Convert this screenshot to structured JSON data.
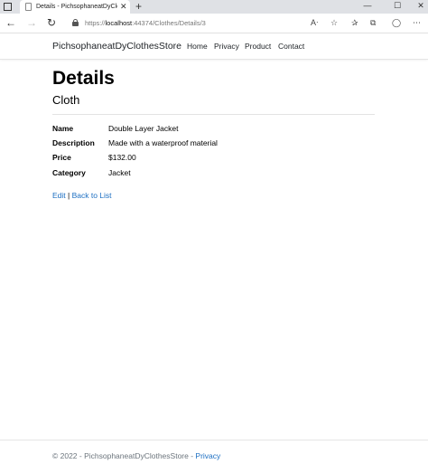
{
  "browser": {
    "tab_title": "Details - PichsophaneatDyClothes",
    "tab_close": "✕",
    "new_tab": "+",
    "url_prefix": "https://",
    "url_host": "localhost",
    "url_rest": ":44374/Clothes/Details/3",
    "minimize": "—",
    "maximize": "☐",
    "close": "✕",
    "back_icon": "←",
    "forward_icon": "→",
    "refresh_icon": "↻"
  },
  "navbar": {
    "brand": "PichsophaneatDyClothesStore",
    "links": [
      "Home",
      "Privacy",
      "Product",
      "Contact"
    ]
  },
  "page": {
    "title": "Details",
    "subtitle": "Cloth"
  },
  "details": [
    {
      "label": "Name",
      "value": "Double Layer Jacket"
    },
    {
      "label": "Description",
      "value": "Made with a waterproof material"
    },
    {
      "label": "Price",
      "value": "$132.00"
    },
    {
      "label": "Category",
      "value": "Jacket"
    }
  ],
  "actions": {
    "edit": "Edit",
    "separator": " | ",
    "back": "Back to List"
  },
  "footer": {
    "text": "© 2022 - PichsophaneatDyClothesStore - ",
    "privacy": "Privacy"
  },
  "colors": {
    "link": "#1b6ec2",
    "tabbar": "#dfe1e5"
  }
}
